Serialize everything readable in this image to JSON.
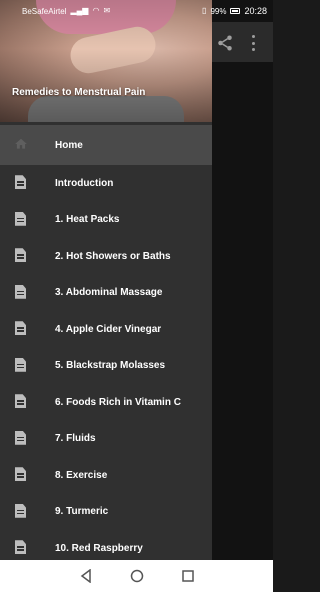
{
  "status_bar": {
    "carrier": "BeSafeAirtel",
    "battery": "99%",
    "time": "20:28"
  },
  "drawer": {
    "header_title": "Remedies to Menstrual Pain",
    "items": [
      {
        "label": "Home",
        "icon": "home-icon",
        "active": true
      },
      {
        "label": "Introduction",
        "icon": "document-icon"
      },
      {
        "label": "1. Heat Packs",
        "icon": "document-icon"
      },
      {
        "label": "2. Hot Showers or Baths",
        "icon": "document-icon"
      },
      {
        "label": "3. Abdominal Massage",
        "icon": "document-icon"
      },
      {
        "label": "4. Apple Cider Vinegar",
        "icon": "document-icon"
      },
      {
        "label": "5. Blackstrap Molasses",
        "icon": "document-icon"
      },
      {
        "label": "6. Foods Rich in Vitamin C",
        "icon": "document-icon"
      },
      {
        "label": "7. Fluids",
        "icon": "document-icon"
      },
      {
        "label": "8. Exercise",
        "icon": "document-icon"
      },
      {
        "label": "9. Turmeric",
        "icon": "document-icon"
      },
      {
        "label": "10. Red Raspberry",
        "icon": "document-icon"
      }
    ]
  },
  "app_bar": {
    "actions": [
      "share-icon",
      "more-vert-icon"
    ]
  },
  "navigation_bar": {
    "buttons": [
      "back-icon",
      "home-circle-icon",
      "recents-icon"
    ]
  },
  "colors": {
    "drawer_bg": "#303030",
    "active_item_bg": "#4a4a4a",
    "text": "#ffffff",
    "icon": "#bdbdbd"
  }
}
